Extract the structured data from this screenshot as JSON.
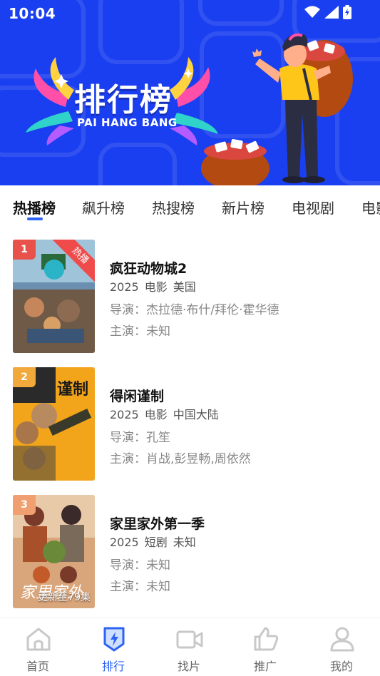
{
  "status_bar": {
    "time": "10:04",
    "icons": [
      "wifi-icon",
      "signal-icon",
      "battery-charging-icon"
    ]
  },
  "hero": {
    "title_cn": "排行榜",
    "title_en": "PAI HANG BANG"
  },
  "tabs": [
    {
      "label": "热播榜",
      "active": true
    },
    {
      "label": "飙升榜",
      "active": false
    },
    {
      "label": "热搜榜",
      "active": false
    },
    {
      "label": "新片榜",
      "active": false
    },
    {
      "label": "电视剧",
      "active": false
    },
    {
      "label": "电影",
      "active": false
    }
  ],
  "list": [
    {
      "rank": "1",
      "rank_color": "#e8524a",
      "badge": "热播",
      "poster_caption": "",
      "title": "疯狂动物城2",
      "year": "2025",
      "type": "电影",
      "region": "美国",
      "director": "导演：杰拉德·布什/拜伦·霍华德",
      "cast": "主演：未知"
    },
    {
      "rank": "2",
      "rank_color": "#f0a93a",
      "badge": "",
      "poster_caption": "",
      "title": "得闲谨制",
      "year": "2025",
      "type": "电影",
      "region": "中国大陆",
      "director": "导演：孔笙",
      "cast": "主演：肖战,彭昱畅,周依然"
    },
    {
      "rank": "3",
      "rank_color": "#f0a070",
      "badge": "",
      "poster_caption": "更新至79集",
      "title": "家里家外第一季",
      "year": "2025",
      "type": "短剧",
      "region": "未知",
      "director": "导演：未知",
      "cast": "主演：未知"
    }
  ],
  "bottom_nav": [
    {
      "label": "首页",
      "icon": "home-icon",
      "active": false
    },
    {
      "label": "排行",
      "icon": "ranking-badge-icon",
      "active": true
    },
    {
      "label": "找片",
      "icon": "video-camera-icon",
      "active": false
    },
    {
      "label": "推广",
      "icon": "thumbs-up-icon",
      "active": false
    },
    {
      "label": "我的",
      "icon": "user-icon",
      "active": false
    }
  ],
  "colors": {
    "hero_bg": "#1a3ff0",
    "accent": "#2d63f5",
    "hot_badge": "#ef4b4b"
  }
}
